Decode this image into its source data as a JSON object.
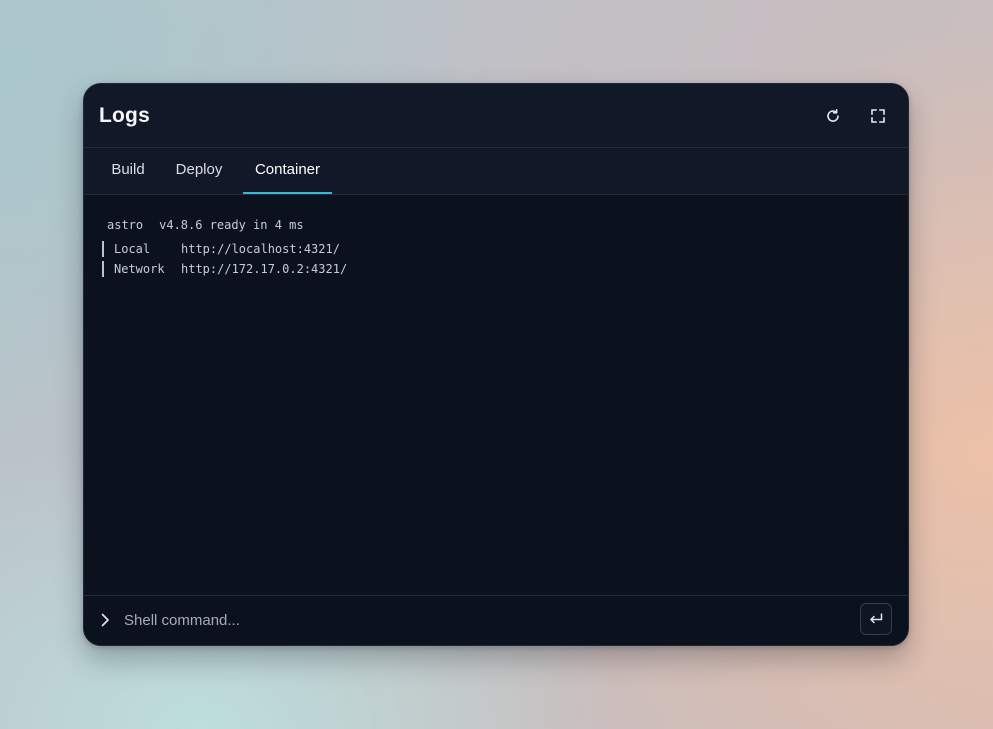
{
  "window": {
    "title": "Logs",
    "refresh_icon": "refresh-icon",
    "expand_icon": "fullscreen-icon"
  },
  "tabs": [
    {
      "label": "Build",
      "active": false
    },
    {
      "label": "Deploy",
      "active": false
    },
    {
      "label": "Container",
      "active": true
    }
  ],
  "log": {
    "header_name": "astro",
    "header_text": "v4.8.6 ready in 4 ms",
    "entries": [
      {
        "label": "Local",
        "url": "http://localhost:4321/"
      },
      {
        "label": "Network",
        "url": "http://172.17.0.2:4321/"
      }
    ]
  },
  "shell": {
    "placeholder": "Shell command...",
    "value": "",
    "prompt_icon": "chevron-right-icon",
    "submit_icon": "enter-icon"
  },
  "colors": {
    "accent": "#38b8d6",
    "panel_bg": "#0b111d",
    "header_bg": "#111827",
    "text": "#c6cdd7"
  }
}
